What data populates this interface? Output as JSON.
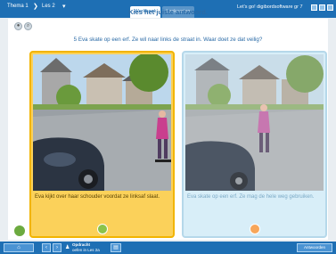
{
  "topbar": {
    "crumb_theme": "Thema 1",
    "crumb_les": "Les 2",
    "tab_active": "Werkboek",
    "tab_inactive": "Leskaarten",
    "brand": "Let's go! digibordsoftware gr 7"
  },
  "exercise": {
    "title": "Kies het juiste antwoord.",
    "question": "5  Eva skate op een erf. Ze wil naar links de straat in. Waar doet ze dat veilig?"
  },
  "answers": [
    {
      "caption": "Eva kijkt over haar schouder voordat ze linksaf slaat.",
      "selected": true
    },
    {
      "caption": "Eva skate op een erf. Ze mag de hele weg gebruiken.",
      "selected": false
    }
  ],
  "bottombar": {
    "assignment_label": "Opdracht",
    "assignment_sub": "oefen in Les 2a",
    "right_label": "Antwoorden"
  },
  "colors": {
    "primary": "#1e6fb4",
    "selected_card": "#fbd15a",
    "card": "#d8eef8"
  }
}
